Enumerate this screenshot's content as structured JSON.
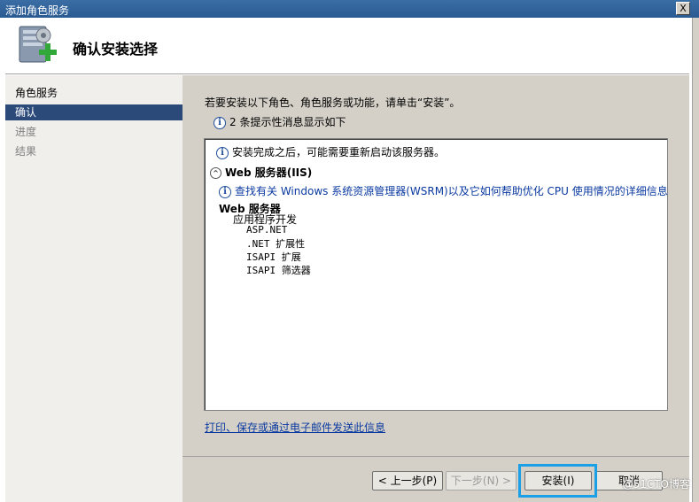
{
  "window": {
    "title": "添加角色服务",
    "close_glyph": "X"
  },
  "header": {
    "title": "确认安装选择",
    "icon": "server-add-icon"
  },
  "sidebar": {
    "items": [
      {
        "label": "角色服务",
        "state": "done"
      },
      {
        "label": "确认",
        "state": "active"
      },
      {
        "label": "进度",
        "state": "pending"
      },
      {
        "label": "结果",
        "state": "pending"
      }
    ]
  },
  "main": {
    "intro": "若要安装以下角色、角色服务或功能，请单击“安装”。",
    "warning": "2 条提示性消息显示如下",
    "panel": {
      "restart_note": "安装完成之后，可能需要重新启动该服务器。",
      "section_title": "Web 服务器(IIS)",
      "link_text": "查找有关 Windows 系统资源管理器(WSRM)以及它如何帮助优化 CPU 使用情况的详细信息",
      "tree_root": "Web 服务器",
      "tree_group": "应用程序开发",
      "tree_items": [
        "ASP.NET",
        ".NET 扩展性",
        "ISAPI 扩展",
        "ISAPI 筛选器"
      ]
    },
    "print_link": "打印、保存或通过电子邮件发送此信息"
  },
  "footer": {
    "prev": "< 上一步(P)",
    "next": "下一步(N) >",
    "install": "安装(I)",
    "cancel": "取消"
  },
  "watermark": "@51CTO博客",
  "colors": {
    "accent_highlight": "#1aa0e6",
    "sidebar_active": "#2b4a7a",
    "link": "#0b3aa0"
  }
}
